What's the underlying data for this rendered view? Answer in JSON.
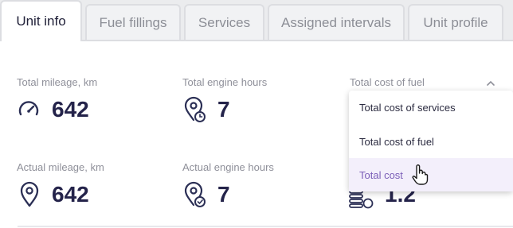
{
  "tabs": [
    {
      "label": "Unit info",
      "active": true
    },
    {
      "label": "Fuel fillings",
      "active": false
    },
    {
      "label": "Services",
      "active": false
    },
    {
      "label": "Assigned intervals",
      "active": false
    },
    {
      "label": "Unit profile",
      "active": false
    }
  ],
  "stats": {
    "total_mileage": {
      "label": "Total mileage, km",
      "value": "642",
      "icon": "gauge-icon"
    },
    "total_engine_hours": {
      "label": "Total engine hours",
      "value": "7",
      "icon": "engine-hours-pin-icon"
    },
    "total_cost_select": {
      "label": "Total cost of fuel",
      "icon": "chevron-up-icon"
    },
    "actual_mileage": {
      "label": "Actual mileage, km",
      "value": "642",
      "icon": "location-pin-icon"
    },
    "actual_engine_hours": {
      "label": "Actual engine hours",
      "value": "7",
      "icon": "engine-hours-check-icon"
    },
    "total_cost": {
      "value": "1.2",
      "icon": "coins-icon"
    }
  },
  "dropdown": {
    "options": [
      "Total cost of services",
      "Total cost of fuel",
      "Total cost"
    ],
    "highlighted_index": 2
  },
  "colors": {
    "accent": "#7b5fb8",
    "value_text": "#24234a",
    "icon": "#2b2f55"
  }
}
